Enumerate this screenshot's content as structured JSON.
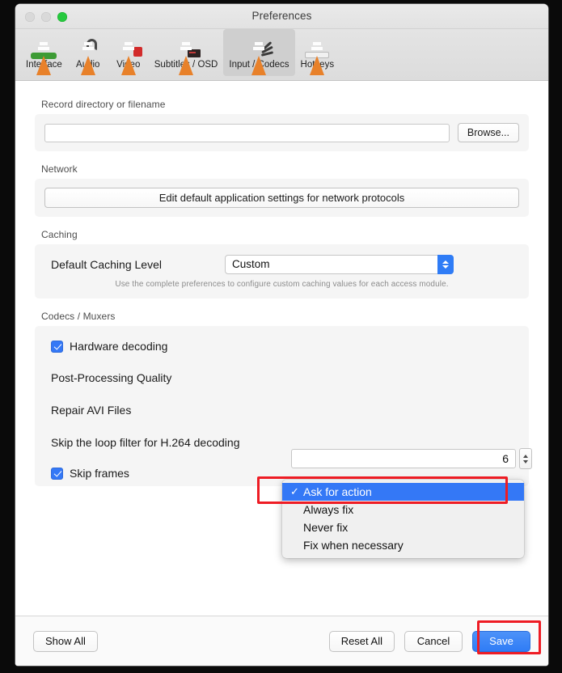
{
  "window": {
    "title": "Preferences",
    "traffic_lights": [
      "close-button",
      "minimize-button",
      "zoom-button"
    ]
  },
  "tabs": [
    {
      "label": "Interface",
      "icon": "vlc-cone-interface-icon",
      "selected": false
    },
    {
      "label": "Audio",
      "icon": "vlc-cone-audio-icon",
      "selected": false
    },
    {
      "label": "Video",
      "icon": "vlc-cone-video-icon",
      "selected": false
    },
    {
      "label": "Subtitles / OSD",
      "icon": "vlc-cone-subtitles-icon",
      "selected": false
    },
    {
      "label": "Input / Codecs",
      "icon": "vlc-cone-input-codecs-icon",
      "selected": true
    },
    {
      "label": "Hotkeys",
      "icon": "vlc-cone-hotkeys-icon",
      "selected": false
    }
  ],
  "record": {
    "group_label": "Record directory or filename",
    "field_value": "",
    "field_placeholder": "",
    "browse_label": "Browse..."
  },
  "network": {
    "group_label": "Network",
    "button_label": "Edit default application settings for network protocols"
  },
  "caching": {
    "group_label": "Caching",
    "row_label": "Default Caching Level",
    "selected_value": "Custom",
    "hint": "Use the complete preferences to configure custom caching values for each access module."
  },
  "codecs": {
    "group_label": "Codecs / Muxers",
    "hardware_decoding_label": "Hardware decoding",
    "hardware_decoding_checked": true,
    "post_processing_label": "Post-Processing Quality",
    "post_processing_value": "6",
    "repair_avi_label": "Repair AVI Files",
    "skip_loop_filter_label": "Skip the loop filter for H.264 decoding",
    "skip_frames_label": "Skip frames",
    "skip_frames_checked": true
  },
  "dropdown": {
    "open": true,
    "items": [
      {
        "label": "Ask for action",
        "checked": true
      },
      {
        "label": "Always fix",
        "checked": false
      },
      {
        "label": "Never fix",
        "checked": false
      },
      {
        "label": "Fix when necessary",
        "checked": false
      }
    ],
    "check_glyph": "✓"
  },
  "footer": {
    "show_all_label": "Show All",
    "reset_all_label": "Reset All",
    "cancel_label": "Cancel",
    "save_label": "Save"
  },
  "annotations": {
    "highlight_color": "#ee1c24",
    "targets": [
      "dropdown-item-ask-for-action",
      "save-button"
    ]
  },
  "colors": {
    "accent_blue": "#3478f6",
    "window_chrome": "#e2e2e2",
    "panel_bg": "#f5f5f5",
    "green_light": "#27c93f"
  }
}
